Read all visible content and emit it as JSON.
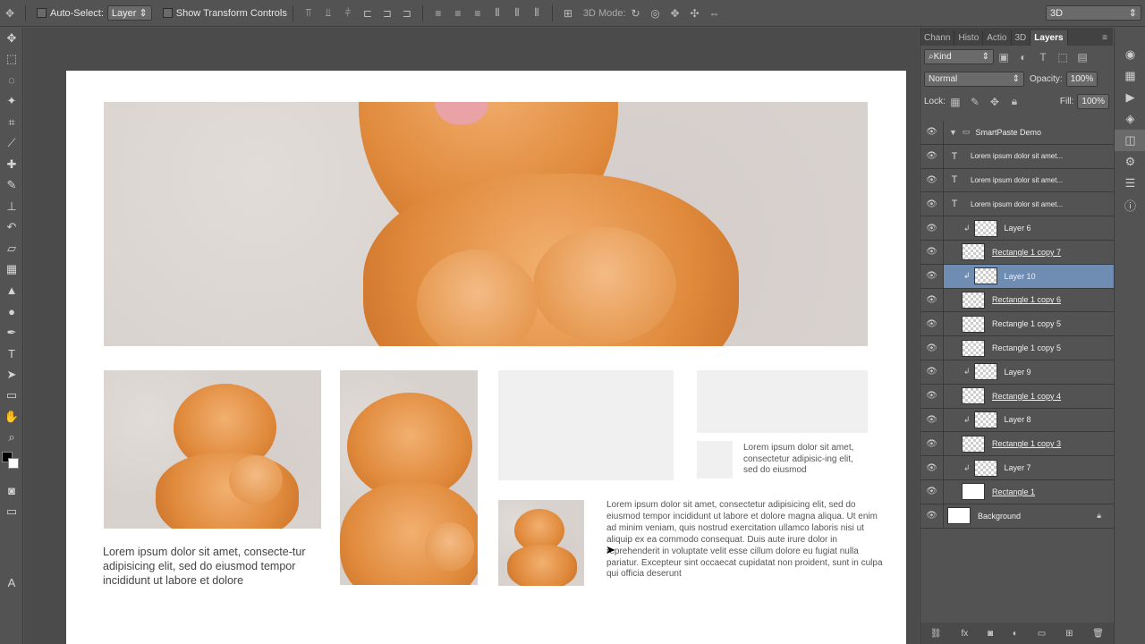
{
  "options_bar": {
    "auto_select_label": "Auto-Select:",
    "auto_select_value": "Layer",
    "transform_label": "Show Transform Controls",
    "mode_label": "3D Mode:",
    "workspace_value": "3D"
  },
  "panel_tabs": [
    "Chann",
    "Histo",
    "Actio",
    "3D",
    "Layers"
  ],
  "layers_panel": {
    "kind_filter": "Kind",
    "blend_mode": "Normal",
    "opacity_label": "Opacity:",
    "opacity_value": "100%",
    "lock_label": "Lock:",
    "fill_label": "Fill:",
    "fill_value": "100%",
    "layers": [
      {
        "name": "SmartPaste Demo",
        "kind": "group"
      },
      {
        "name": "Lorem ipsum dolor sit amet...",
        "kind": "text"
      },
      {
        "name": "Lorem ipsum dolor sit amet...",
        "kind": "text"
      },
      {
        "name": "Lorem ipsum dolor sit amet...",
        "kind": "text"
      },
      {
        "name": "Layer 6",
        "kind": "clip"
      },
      {
        "name": "Rectangle 1 copy 7",
        "kind": "shape"
      },
      {
        "name": "Layer 10",
        "kind": "clip",
        "selected": true
      },
      {
        "name": "Rectangle 1 copy 6",
        "kind": "shape"
      },
      {
        "name": "Rectangle 1 copy 5",
        "kind": "shape"
      },
      {
        "name": "Rectangle 1 copy 5",
        "kind": "shape"
      },
      {
        "name": "Layer 9",
        "kind": "clip"
      },
      {
        "name": "Rectangle 1 copy 4",
        "kind": "shape"
      },
      {
        "name": "Layer 8",
        "kind": "clip"
      },
      {
        "name": "Rectangle 1 copy 3",
        "kind": "shape"
      },
      {
        "name": "Layer 7",
        "kind": "clip"
      },
      {
        "name": "Rectangle 1",
        "kind": "shape"
      },
      {
        "name": "Background",
        "kind": "background"
      }
    ]
  },
  "canvas": {
    "text_left": "Lorem ipsum dolor sit amet, consecte-tur adipisicing elit, sed do eiusmod tempor incididunt ut labore et dolore",
    "text_small": "Lorem ipsum dolor sit amet, consectetur adipisic-ing elit, sed do eiusmod",
    "text_long": "Lorem ipsum dolor sit amet, consectetur adipisicing elit, sed do eiusmod tempor incididunt ut labore et dolore magna aliqua. Ut enim ad minim veniam, quis nostrud exercitation ullamco laboris nisi ut aliquip ex ea commodo consequat. Duis aute irure dolor in reprehenderit in voluptate velit esse cillum dolore eu fugiat nulla pariatur. Excepteur sint occaecat cupidatat non proident, sunt in culpa qui officia deserunt"
  }
}
